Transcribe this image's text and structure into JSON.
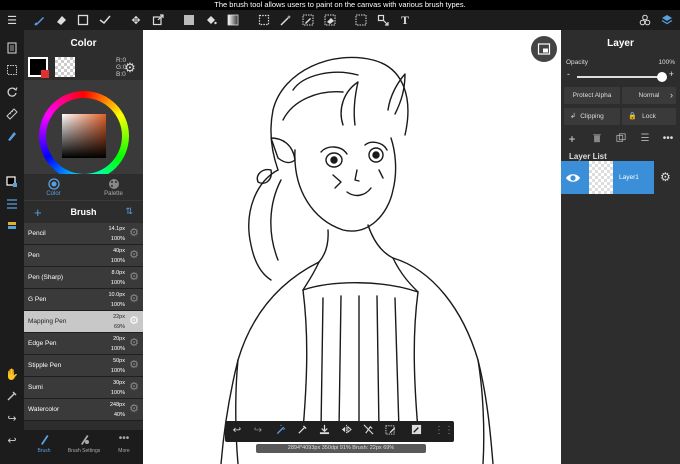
{
  "caption": "The brush tool allows users to paint on the canvas with various brush types.",
  "toolbar": {
    "icons": [
      "menu-icon",
      "brush-icon",
      "eraser-icon",
      "square-icon",
      "brush-stroke-icon",
      "move-icon",
      "transform-icon",
      "fill-color-icon",
      "bucket-icon",
      "gradient-icon",
      "select-rect-icon",
      "magic-wand-icon",
      "select-pen-icon",
      "select-eraser-icon",
      "select-move-icon",
      "crop-icon",
      "text-icon",
      "material-icon",
      "layers-icon"
    ]
  },
  "color_panel": {
    "title": "Color",
    "rgb": {
      "r": "R:0",
      "g": "G:0",
      "b": "B:0"
    },
    "primary_color": "#000000",
    "secondary_color": "transparent",
    "tabs": [
      {
        "label": "Color",
        "active": true
      },
      {
        "label": "Palette",
        "active": false
      }
    ]
  },
  "brush_panel": {
    "title": "Brush",
    "items": [
      {
        "name": "Pencil",
        "size": "14.1px",
        "opacity": "100%",
        "selected": false
      },
      {
        "name": "Pen",
        "size": "40px",
        "opacity": "100%",
        "selected": false
      },
      {
        "name": "Pen (Sharp)",
        "size": "8.0px",
        "opacity": "100%",
        "selected": false
      },
      {
        "name": "G Pen",
        "size": "10.0px",
        "opacity": "100%",
        "selected": false
      },
      {
        "name": "Mapping Pen",
        "size": "22px",
        "opacity": "69%",
        "selected": true
      },
      {
        "name": "Edge Pen",
        "size": "20px",
        "opacity": "100%",
        "selected": false
      },
      {
        "name": "Stipple Pen",
        "size": "50px",
        "opacity": "100%",
        "selected": false
      },
      {
        "name": "Sumi",
        "size": "30px",
        "opacity": "100%",
        "selected": false
      },
      {
        "name": "Watercolor",
        "size": "248px",
        "opacity": "40%",
        "selected": false
      }
    ]
  },
  "bottom_tabs": [
    {
      "label": "Brush",
      "active": true
    },
    {
      "label": "Brush Settings",
      "active": false
    },
    {
      "label": "More",
      "active": false
    }
  ],
  "layer_panel": {
    "title": "Layer",
    "opacity_label": "Opacity",
    "opacity_value": "100%",
    "opacity_fraction": 1.0,
    "protect_alpha": "Protect Alpha",
    "blend_mode": "Normal",
    "clipping": "Clipping",
    "lock": "Lock",
    "layer_list_label": "Layer List",
    "layers": [
      {
        "name": "Layer1",
        "visible": true,
        "selected": true
      }
    ]
  },
  "status": "2894*4093px 350dpi 91% Brush: 22px 69%",
  "accent_color": "#3a8fd8"
}
